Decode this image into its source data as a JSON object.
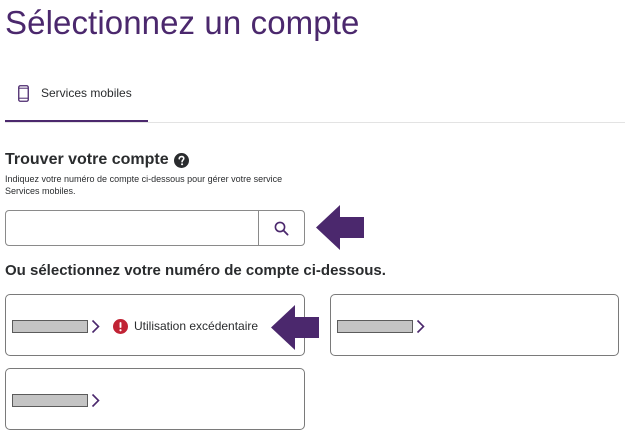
{
  "page": {
    "title": "Sélectionnez un compte"
  },
  "tabs": [
    {
      "label": "Services mobiles",
      "icon": "mobile-phone-icon",
      "active": true
    }
  ],
  "find_account": {
    "heading": "Trouver votre compte",
    "help_icon": "help-circle-icon",
    "help_text": "Indiquez votre numéro de compte ci-dessous pour gérer votre service Services mobiles.",
    "search_value": "",
    "search_icon": "search-icon"
  },
  "select_account": {
    "heading": "Ou sélectionnez votre numéro de compte ci-dessous.",
    "accounts": [
      {
        "number": "",
        "alert_icon": "error-icon",
        "alert_text": "Utilisation excédentaire"
      },
      {
        "number": ""
      },
      {
        "number": ""
      }
    ]
  },
  "colors": {
    "brand": "#4b286d",
    "alert": "#c12335",
    "arrow": "#4b286d",
    "redaction": "#c4c4c4"
  }
}
